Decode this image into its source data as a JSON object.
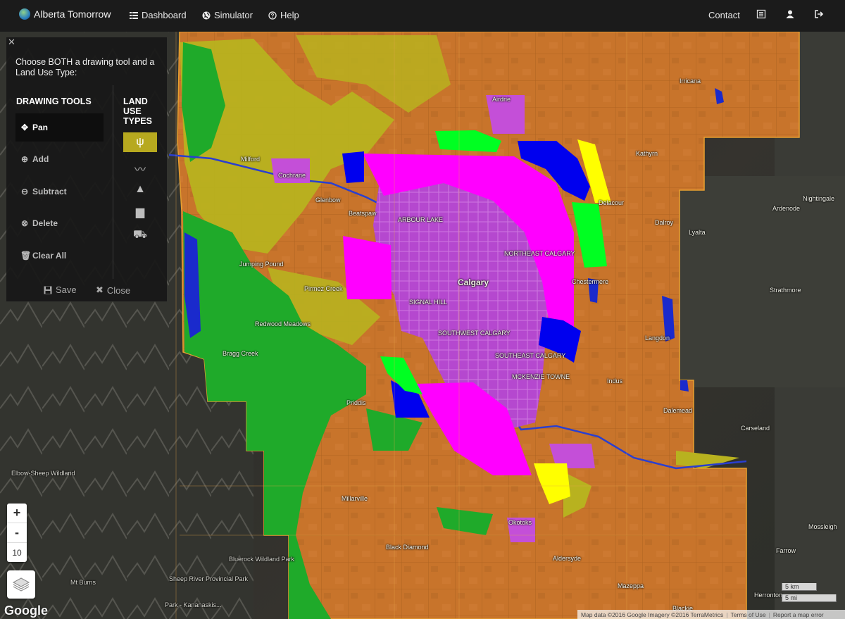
{
  "app": {
    "title": "Alberta Tomorrow"
  },
  "nav": {
    "dashboard": "Dashboard",
    "simulator": "Simulator",
    "help": "Help",
    "contact": "Contact"
  },
  "icons": {
    "brand": "globe-icon",
    "dashboard": "list-icon",
    "simulator": "globe-icon",
    "help": "question-circle-icon",
    "document": "document-icon",
    "user": "user-icon",
    "logout": "logout-icon"
  },
  "panel": {
    "close_glyph": "✕",
    "instruction": "Choose BOTH a drawing tool and a Land Use Type:",
    "tools_header": "DRAWING TOOLS",
    "types_header": "LAND USE TYPES",
    "tools": [
      {
        "label": "Pan",
        "icon": "✥"
      },
      {
        "label": "Add",
        "icon": "⊕"
      },
      {
        "label": "Subtract",
        "icon": "⊖"
      },
      {
        "label": "Delete",
        "icon": "⊗"
      },
      {
        "label": "Clear All",
        "icon": "🗑"
      }
    ],
    "land_use_types": [
      {
        "name": "grassland-icon",
        "glyph": "ψ",
        "selected": true
      },
      {
        "name": "water-icon",
        "glyph": "〰",
        "selected": false
      },
      {
        "name": "forest-icon",
        "glyph": "▲",
        "selected": false
      },
      {
        "name": "settlement-icon",
        "glyph": "▆",
        "selected": false
      },
      {
        "name": "agriculture-icon",
        "glyph": "⛟",
        "selected": false
      }
    ],
    "save_label": "Save",
    "close_label": "Close"
  },
  "map": {
    "zoom_in": "+",
    "zoom_out": "-",
    "zoom_level": "10",
    "google": "Google",
    "scale_km": "5 km",
    "scale_mi": "5 mi",
    "attribution": {
      "data": "Map data ©2016 Google Imagery ©2016 TerraMetrics",
      "terms": "Terms of Use",
      "report": "Report a map error"
    },
    "places": {
      "calgary": "Calgary",
      "airdrie": "Airdrie",
      "cochrane": "Cochrane",
      "glenbow": "Glenbow",
      "beatspaw": "Beatspaw",
      "arbour_lake": "ARBOUR LAKE",
      "chestermere": "Chestermere",
      "langdon": "Langdon",
      "indus": "Indus",
      "dalemead": "Dalemead",
      "carseland": "Carseland",
      "okotoks": "Okotoks",
      "aldersyde": "Aldersyde",
      "mazeppa": "Mazeppa",
      "black_diamond": "Black Diamond",
      "millarville": "Millarville",
      "priddis": "Priddis",
      "bragg_creek": "Bragg Creek",
      "redwood_meadows": "Redwood Meadows",
      "jumping_pound": "Jumping Pound",
      "pirmez_creek": "Pirmez Creek",
      "milford": "Milford",
      "kathyrn": "Kathyrn",
      "irricana": "Irricana",
      "delacour": "Delacour",
      "dalroy": "Dalroy",
      "lyalta": "Lyalta",
      "ardenode": "Ardenode",
      "nightingale": "Nightingale",
      "strathmore": "Strathmore",
      "mossleigh": "Mossleigh",
      "farrow": "Farrow",
      "herronton": "Herronton",
      "blackie": "Blackie",
      "elbow_sheep": "Elbow-Sheep Wildland",
      "bluerock": "Bluerock Wildland Park",
      "sheep_river": "Sheep River Provincial Park",
      "kananaskis": "Park - Kananaskis...",
      "mt_burns": "Mt Burns",
      "signal_hill": "SIGNAL HILL",
      "southwest_calgary": "SOUTHWEST CALGARY",
      "southeast_calgary": "SOUTHEAST CALGARY",
      "northeast_calgary": "NORTHEAST CALGARY",
      "mckenzie_towne": "MCKENZIE TOWNE"
    },
    "colors": {
      "agriculture": "#c8742b",
      "grassland": "#b8b21f",
      "forest": "#1faa2a",
      "settlement": "#c44fd8",
      "drawn_magenta": "#ff00ff",
      "drawn_blue": "#0000ee",
      "drawn_green": "#00ff22",
      "drawn_yellow": "#ffff00"
    }
  }
}
